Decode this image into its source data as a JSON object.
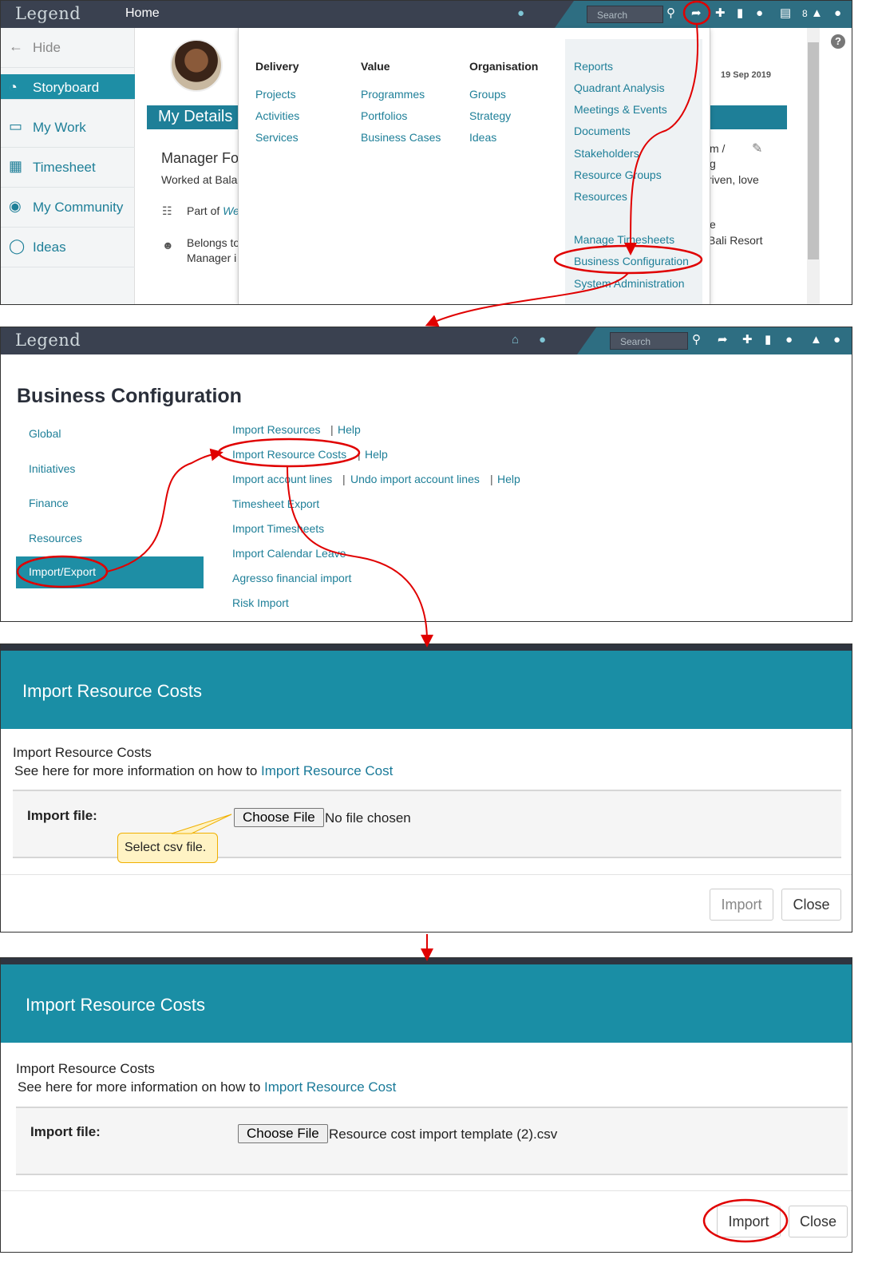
{
  "panel1": {
    "logo": "Legend",
    "home": "Home",
    "search_placeholder": "Search",
    "notif_count": "8",
    "sidebar": [
      {
        "label": "Hide",
        "icon": "arrow-left-icon"
      },
      {
        "label": "Storyboard",
        "icon": "dashboard-icon"
      },
      {
        "label": "My Work",
        "icon": "inbox-icon"
      },
      {
        "label": "Timesheet",
        "icon": "calendar-icon"
      },
      {
        "label": "My Community",
        "icon": "chat-icon"
      },
      {
        "label": "Ideas",
        "icon": "lightbulb-icon"
      }
    ],
    "my_details": "My Details",
    "manager_text": "Manager Fo",
    "worked_at": "Worked at Bala",
    "part_of": "Part of ",
    "part_of_link": "We",
    "belongs": "Belongs to",
    "belongs_line2": "Manager i",
    "date": "19 Sep 2019",
    "right_text": {
      "a": "m /",
      "b": "g",
      "c": "riven, love",
      "d": "e",
      "e": "Bali Resort"
    },
    "mega": {
      "columns": [
        {
          "heading": "Delivery",
          "items": [
            "Projects",
            "Activities",
            "Services"
          ]
        },
        {
          "heading": "Value",
          "items": [
            "Programmes",
            "Portfolios",
            "Business Cases"
          ]
        },
        {
          "heading": "Organisation",
          "items": [
            "Groups",
            "Strategy",
            "Ideas"
          ]
        }
      ],
      "right_items": [
        "Reports",
        "Quadrant Analysis",
        "Meetings & Events",
        "Documents",
        "Stakeholders",
        "Resource Groups",
        "Resources",
        "Manage Timesheets",
        "Business Configuration",
        "System Administration"
      ]
    }
  },
  "panel2": {
    "logo": "Legend",
    "search_placeholder": "Search",
    "title": "Business Configuration",
    "left_nav": [
      "Global",
      "Initiatives",
      "Finance",
      "Resources",
      "Import/Export"
    ],
    "links": {
      "import_resources": "Import Resources",
      "help1": "Help",
      "import_resource_costs": "Import Resource Costs",
      "help2": "Help",
      "import_account_lines": "Import account lines",
      "undo_import": "Undo import account lines",
      "help3": "Help",
      "timesheet_export": "Timesheet Export",
      "import_timesheets": "Import Timesheets",
      "import_calendar_leave": "Import Calendar Leave",
      "agresso": "Agresso financial import",
      "risk_import": "Risk Import"
    }
  },
  "panel3": {
    "header": "Import Resource Costs",
    "subtitle": "Import Resource Costs",
    "info_prefix": "See here for more information on how to ",
    "info_link": "Import Resource Cost",
    "file_label": "Import file:",
    "choose_file": "Choose File",
    "file_status": "No file chosen",
    "callout": "Select csv file.",
    "import_btn": "Import",
    "close_btn": "Close"
  },
  "panel4": {
    "header": "Import Resource Costs",
    "subtitle": "Import Resource Costs",
    "info_prefix": "See here for more information on how to ",
    "info_link": "Import Resource Cost",
    "file_label": "Import file:",
    "choose_file": "Choose File",
    "file_status": "Resource cost import template (2).csv",
    "import_btn": "Import",
    "close_btn": "Close"
  },
  "colors": {
    "teal": "#1a8ea5",
    "dark_bar": "#3a4150",
    "annotation": "#e00000",
    "link": "#1e7f98"
  }
}
